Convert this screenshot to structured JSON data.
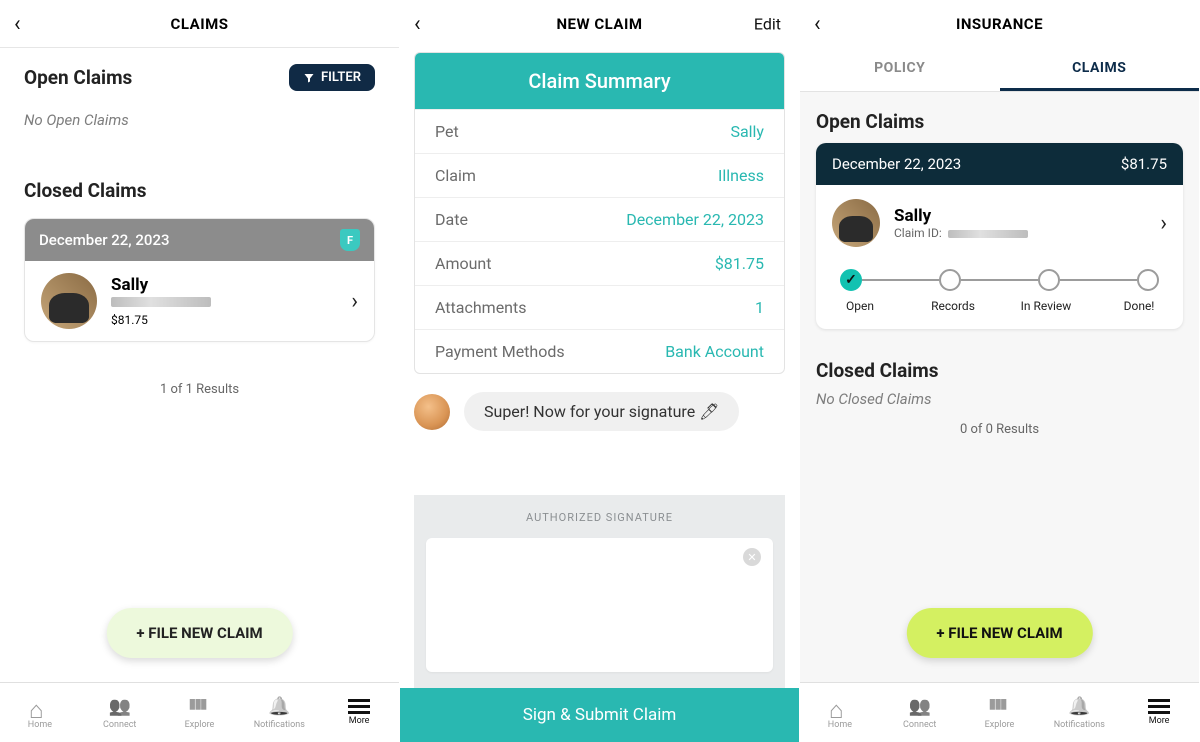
{
  "screen1": {
    "title": "CLAIMS",
    "open_h": "Open Claims",
    "filter": "FILTER",
    "no_open": "No Open Claims",
    "closed_h": "Closed Claims",
    "card_date": "December 22, 2023",
    "pet_name": "Sally",
    "amount": "$81.75",
    "results": "1 of 1 Results",
    "file_new": "+ FILE NEW CLAIM"
  },
  "screen2": {
    "title": "NEW CLAIM",
    "edit": "Edit",
    "summary_head": "Claim Summary",
    "rows": {
      "pet_l": "Pet",
      "pet_v": "Sally",
      "claim_l": "Claim",
      "claim_v": "Illness",
      "date_l": "Date",
      "date_v": "December 22, 2023",
      "amount_l": "Amount",
      "amount_v": "$81.75",
      "attach_l": "Attachments",
      "attach_v": "1",
      "pay_l": "Payment Methods",
      "pay_v": "Bank Account"
    },
    "assistant_msg": "Super! Now for your signature 🖊",
    "sig_title": "AUTHORIZED SIGNATURE",
    "submit": "Sign & Submit Claim"
  },
  "screen3": {
    "title": "INSURANCE",
    "tab_policy": "POLICY",
    "tab_claims": "CLAIMS",
    "open_h": "Open Claims",
    "card_date": "December 22, 2023",
    "card_amount": "$81.75",
    "pet_name": "Sally",
    "claim_id_label": "Claim ID:",
    "progress": {
      "p1": "Open",
      "p2": "Records",
      "p3": "In Review",
      "p4": "Done!"
    },
    "closed_h": "Closed Claims",
    "no_closed": "No Closed Claims",
    "results": "0 of 0 Results",
    "file_new": "+ FILE NEW CLAIM"
  },
  "tabbar": {
    "home": "Home",
    "connect": "Connect",
    "explore": "Explore",
    "notifications": "Notifications",
    "more": "More"
  }
}
